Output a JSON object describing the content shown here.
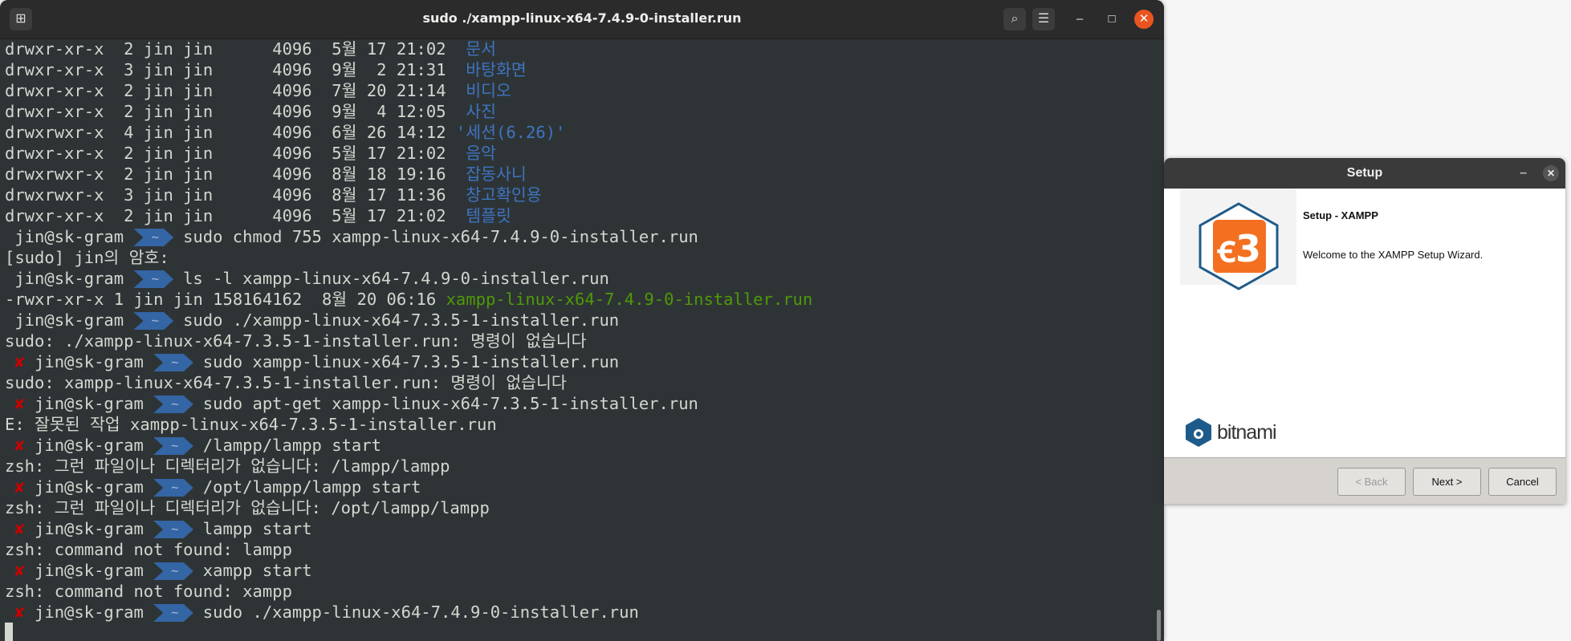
{
  "terminal": {
    "title": "sudo ./xampp-linux-x64-7.4.9-0-installer.run",
    "prompt_user": "jin@sk-gram",
    "prompt_dir": "~",
    "error_mark": "✘",
    "lines": [
      {
        "type": "ls",
        "text": "drwxr-xr-x  2 jin jin      4096  5월 17 21:02  ",
        "name": "문서"
      },
      {
        "type": "ls",
        "text": "drwxr-xr-x  3 jin jin      4096  9월  2 21:31  ",
        "name": "바탕화면"
      },
      {
        "type": "ls",
        "text": "drwxr-xr-x  2 jin jin      4096  7월 20 21:14  ",
        "name": "비디오"
      },
      {
        "type": "ls",
        "text": "drwxr-xr-x  2 jin jin      4096  9월  4 12:05  ",
        "name": "사진"
      },
      {
        "type": "ls",
        "text": "drwxrwxr-x  4 jin jin      4096  6월 26 14:12 ",
        "name": "'세션(6.26)'"
      },
      {
        "type": "ls",
        "text": "drwxr-xr-x  2 jin jin      4096  5월 17 21:02  ",
        "name": "음악"
      },
      {
        "type": "ls",
        "text": "drwxrwxr-x  2 jin jin      4096  8월 18 19:16  ",
        "name": "잡동사니"
      },
      {
        "type": "ls",
        "text": "drwxrwxr-x  3 jin jin      4096  8월 17 11:36  ",
        "name": "창고확인용"
      },
      {
        "type": "ls",
        "text": "drwxr-xr-x  2 jin jin      4096  5월 17 21:02  ",
        "name": "템플릿"
      },
      {
        "type": "prompt",
        "error": false,
        "cmd": "sudo chmod 755 xampp-linux-x64-7.4.9-0-installer.run"
      },
      {
        "type": "out",
        "text": "[sudo] jin의 암호:"
      },
      {
        "type": "prompt",
        "error": false,
        "cmd": "ls -l xampp-linux-x64-7.4.9-0-installer.run"
      },
      {
        "type": "ls-green",
        "text": "-rwxr-xr-x 1 jin jin 158164162  8월 20 06:16 ",
        "name": "xampp-linux-x64-7.4.9-0-installer.run"
      },
      {
        "type": "prompt",
        "error": false,
        "cmd": "sudo ./xampp-linux-x64-7.3.5-1-installer.run"
      },
      {
        "type": "out",
        "text": "sudo: ./xampp-linux-x64-7.3.5-1-installer.run: 명령이 없습니다"
      },
      {
        "type": "prompt",
        "error": true,
        "cmd": "sudo xampp-linux-x64-7.3.5-1-installer.run"
      },
      {
        "type": "out",
        "text": "sudo: xampp-linux-x64-7.3.5-1-installer.run: 명령이 없습니다"
      },
      {
        "type": "prompt",
        "error": true,
        "cmd": "sudo apt-get xampp-linux-x64-7.3.5-1-installer.run"
      },
      {
        "type": "out",
        "text": "E: 잘못된 작업 xampp-linux-x64-7.3.5-1-installer.run"
      },
      {
        "type": "prompt",
        "error": true,
        "cmd": "/lampp/lampp start"
      },
      {
        "type": "out",
        "text": "zsh: 그런 파일이나 디렉터리가 없습니다: /lampp/lampp"
      },
      {
        "type": "prompt",
        "error": true,
        "cmd": "/opt/lampp/lampp start"
      },
      {
        "type": "out",
        "text": "zsh: 그런 파일이나 디렉터리가 없습니다: /opt/lampp/lampp"
      },
      {
        "type": "prompt",
        "error": true,
        "cmd": "lampp start"
      },
      {
        "type": "out",
        "text": "zsh: command not found: lampp"
      },
      {
        "type": "prompt",
        "error": true,
        "cmd": "xampp start"
      },
      {
        "type": "out",
        "text": "zsh: command not found: xampp"
      },
      {
        "type": "prompt",
        "error": true,
        "cmd": "sudo ./xampp-linux-x64-7.4.9-0-installer.run"
      },
      {
        "type": "cursor"
      }
    ]
  },
  "setup": {
    "title": "Setup",
    "heading": "Setup - XAMPP",
    "welcome": "Welcome to the XAMPP Setup Wizard.",
    "brand": "bitnami",
    "back_label": "< Back",
    "next_label": "Next >",
    "cancel_label": "Cancel"
  },
  "colors": {
    "terminal_bg": "#2e3436",
    "prompt_segment": "#3465a4",
    "dir_blue": "#3e74c1",
    "exec_green": "#4e9a06",
    "error_red": "#cc0000",
    "xampp_orange": "#f37021",
    "close_orange": "#e95420"
  }
}
